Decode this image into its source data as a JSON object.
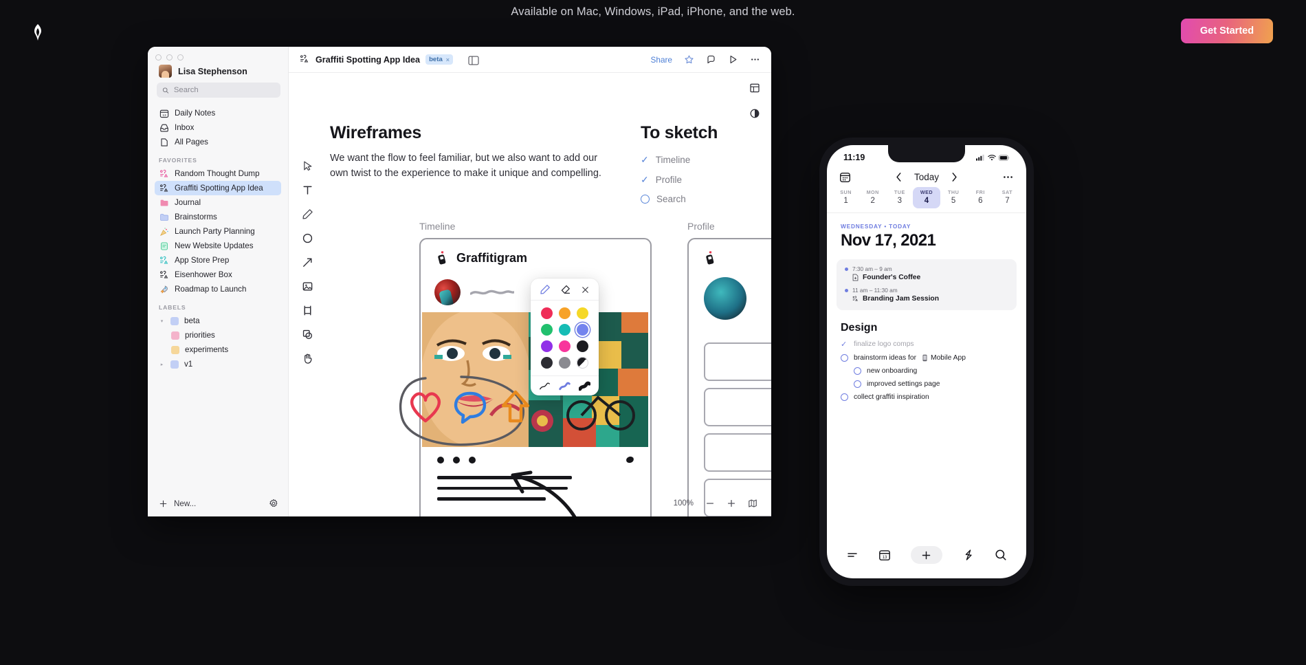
{
  "promo": {
    "text": "Available on Mac, Windows, iPad, iPhone, and the web.",
    "cta_label": "Get Started",
    "logo_icon": "craft-logo-icon",
    "cta_gradient": "#e14bb0 → #f0a24e"
  },
  "app": {
    "sidebar": {
      "user_name": "Lisa Stephenson",
      "search_placeholder": "Search",
      "search_value": "",
      "nav": [
        {
          "label": "Daily Notes",
          "icon": "calendar-icon"
        },
        {
          "label": "Inbox",
          "icon": "inbox-icon"
        },
        {
          "label": "All Pages",
          "icon": "page-icon"
        }
      ],
      "favorites_header": "FAVORITES",
      "favorites": [
        {
          "label": "Random Thought Dump",
          "icon": "doc-list-icon",
          "color": "#e9559c",
          "active": false
        },
        {
          "label": "Graffiti Spotting App Idea",
          "icon": "doc-list-icon",
          "color": "#2f2f36",
          "active": true
        },
        {
          "label": "Journal",
          "icon": "folder-icon",
          "color": "#f08ab0",
          "active": false
        },
        {
          "label": "Brainstorms",
          "icon": "folder-icon",
          "color": "#9fb4ef",
          "active": false
        },
        {
          "label": "Launch Party Planning",
          "icon": "party-popper-icon",
          "color": "#e8a33c",
          "active": false
        },
        {
          "label": "New Website Updates",
          "icon": "doc-green-icon",
          "color": "#43c891",
          "active": false
        },
        {
          "label": "App Store Prep",
          "icon": "doc-list-icon",
          "color": "#2bbec0",
          "active": false
        },
        {
          "label": "Eisenhower Box",
          "icon": "doc-list-icon",
          "color": "#2f2f36",
          "active": false
        },
        {
          "label": "Roadmap to Launch",
          "icon": "rocket-icon",
          "color": "#d94f46",
          "active": false
        }
      ],
      "labels_header": "LABELS",
      "labels": [
        {
          "label": "beta",
          "icon": "folder-icon",
          "color": "#9fb4ef",
          "indent": 0,
          "expanded": true
        },
        {
          "label": "priorities",
          "icon": "folder-icon",
          "color": "#f08ab0",
          "indent": 1,
          "expanded": false
        },
        {
          "label": "experiments",
          "icon": "folder-icon",
          "color": "#f0c05a",
          "indent": 1,
          "expanded": false
        },
        {
          "label": "v1",
          "icon": "folder-icon",
          "color": "#9fb4ef",
          "indent": 0,
          "expanded": false
        }
      ],
      "new_label": "New...",
      "new_icon": "plus-icon",
      "settings_icon": "gear-icon"
    },
    "topbar": {
      "doc_icon": "doc-list-icon",
      "title": "Graffiti Spotting App Idea",
      "tag": "beta",
      "tag_close": "×",
      "share_label": "Share",
      "actions": [
        "star-icon",
        "comment-icon",
        "present-icon",
        "more-icon"
      ]
    },
    "tool_rail": [
      "cursor-icon",
      "text-icon",
      "pen-icon",
      "shape-circle-icon",
      "arrow-icon",
      "image-icon",
      "frame-icon",
      "layers-icon",
      "hand-icon"
    ],
    "right_rail": [
      "grid-icon",
      "contrast-icon"
    ],
    "color_popover": {
      "pen_icon": "pen-icon",
      "eraser_icon": "eraser-icon",
      "close_icon": "close-icon",
      "colors": [
        "#ef2d58",
        "#f7a228",
        "#f5d827",
        "#22c06e",
        "#16bcb5",
        "#7484ee",
        "#9130e8",
        "#f8359c",
        "#1b1b20",
        "#2d2d33",
        "#8a8a90",
        "#ffffff"
      ],
      "selected_index": 5,
      "brushes": [
        "thin-stroke-icon",
        "medium-stroke-icon",
        "thick-stroke-icon"
      ],
      "brush_selected_index": 1
    },
    "canvas": {
      "wireframes_title": "Wireframes",
      "wireframes_body": "We want the flow to feel familiar, but we also want to add our own twist to the experience to make it unique and compelling.",
      "to_sketch_title": "To sketch",
      "to_sketch_items": [
        {
          "label": "Timeline",
          "done": true
        },
        {
          "label": "Profile",
          "done": true
        },
        {
          "label": "Search",
          "done": false
        }
      ],
      "frame_timeline_label": "Timeline",
      "frame_profile_label": "Profile",
      "app_name": "Graffitigram",
      "app_icon": "spray-can-icon",
      "zoom_level": "100%",
      "zoom_out_icon": "minus-icon",
      "zoom_in_icon": "plus-icon",
      "map_icon": "map-icon"
    }
  },
  "phone": {
    "status_time": "11:19",
    "status_icons": [
      "signal-icon",
      "wifi-icon",
      "battery-icon"
    ],
    "nav": {
      "calendar_icon": "calendar-icon",
      "prev_icon": "chevron-left-icon",
      "today_label": "Today",
      "next_icon": "chevron-right-icon",
      "more_icon": "more-icon"
    },
    "week": [
      {
        "name": "SUN",
        "date": "1",
        "selected": false
      },
      {
        "name": "MON",
        "date": "2",
        "selected": false
      },
      {
        "name": "TUE",
        "date": "3",
        "selected": false
      },
      {
        "name": "WED",
        "date": "4",
        "selected": true
      },
      {
        "name": "THU",
        "date": "5",
        "selected": false
      },
      {
        "name": "FRI",
        "date": "6",
        "selected": false
      },
      {
        "name": "SAT",
        "date": "7",
        "selected": false
      }
    ],
    "day_weekday": "WEDNESDAY • ",
    "day_today": "TODAY",
    "day_date": "Nov 17, 2021",
    "events": [
      {
        "time": "7:30 am – 9 am",
        "name": "Founder's Coffee",
        "icon": "page-plus-icon"
      },
      {
        "time": "11 am – 11:30 am",
        "name": "Branding Jam Session",
        "icon": "doc-list-icon"
      }
    ],
    "design_header": "Design",
    "tasks": [
      {
        "label": "finalize logo comps",
        "done": true,
        "sub": false,
        "chip": null
      },
      {
        "label": "brainstorm ideas for",
        "done": false,
        "sub": false,
        "chip": "Mobile App",
        "chip_icon": "mobile-icon"
      },
      {
        "label": "new onboarding",
        "done": false,
        "sub": true,
        "chip": null
      },
      {
        "label": "improved settings page",
        "done": false,
        "sub": true,
        "chip": null
      },
      {
        "label": "collect graffiti inspiration",
        "done": false,
        "sub": false,
        "chip": null
      }
    ],
    "tabbar": [
      "list-icon",
      "calendar-icon",
      "plus-icon",
      "flash-icon",
      "search-icon"
    ]
  }
}
